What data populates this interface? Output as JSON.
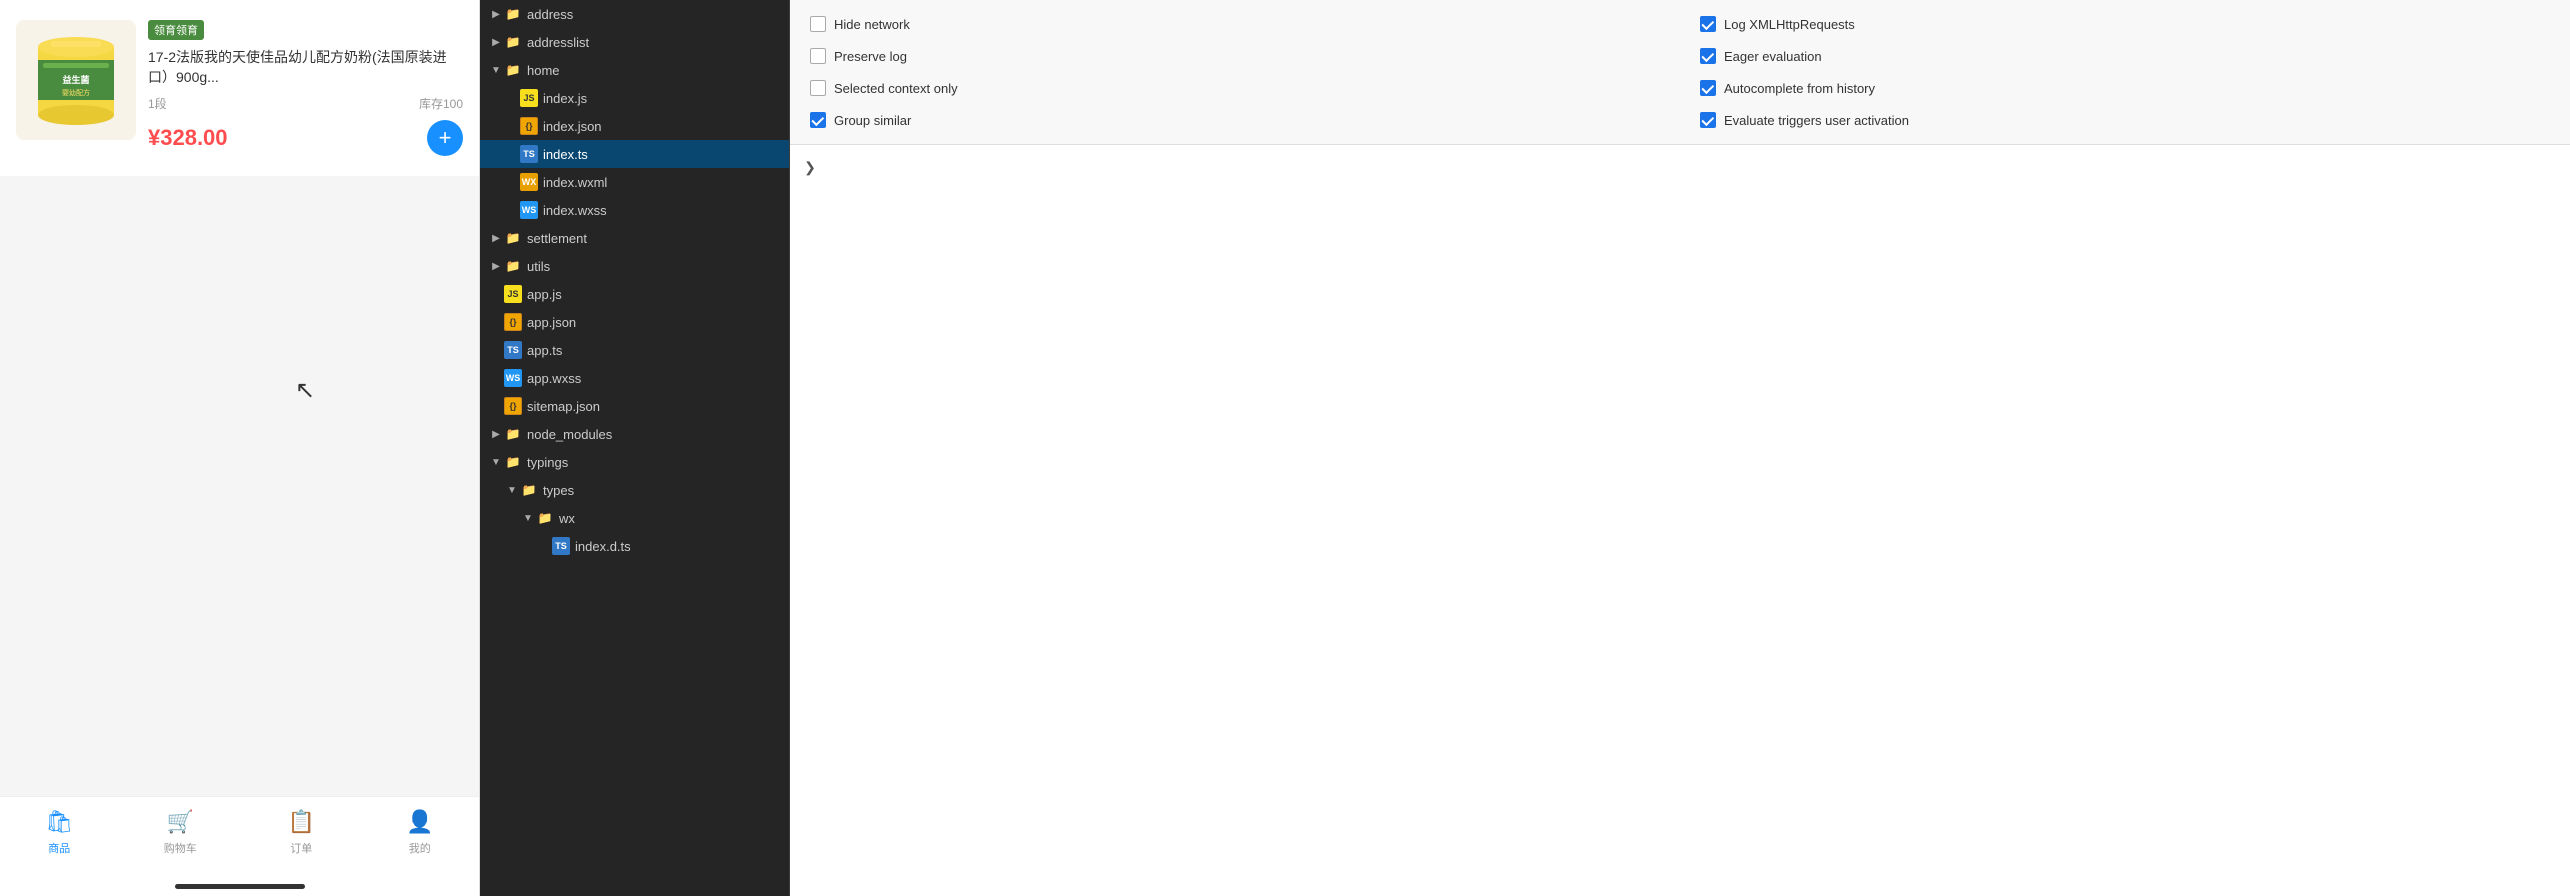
{
  "mobile": {
    "shop_badge": "领育领育",
    "shop_sub": "领育",
    "product_title": "17-2法版我的天使佳品幼儿配方奶粉(法国原装进口）900g...",
    "product_stage": "1段",
    "product_stock": "库存100",
    "product_price": "¥328.00",
    "add_button_label": "+",
    "nav_items": [
      {
        "label": "商品",
        "active": true
      },
      {
        "label": "购物车",
        "active": false
      },
      {
        "label": "订单",
        "active": false
      },
      {
        "label": "我的",
        "active": false
      }
    ]
  },
  "file_tree": {
    "items": [
      {
        "id": "address",
        "name": "address",
        "type": "folder",
        "level": 0,
        "expanded": false,
        "arrow": "▶"
      },
      {
        "id": "addresslist",
        "name": "addresslist",
        "type": "folder",
        "level": 0,
        "expanded": false,
        "arrow": "▶"
      },
      {
        "id": "home",
        "name": "home",
        "type": "folder",
        "level": 0,
        "expanded": true,
        "arrow": "▼"
      },
      {
        "id": "index-js",
        "name": "index.js",
        "type": "js",
        "level": 1
      },
      {
        "id": "index-json",
        "name": "index.json",
        "type": "json",
        "level": 1
      },
      {
        "id": "index-ts",
        "name": "index.ts",
        "type": "ts",
        "level": 1,
        "selected": true
      },
      {
        "id": "index-wxml",
        "name": "index.wxml",
        "type": "wxml",
        "level": 1
      },
      {
        "id": "index-wxss",
        "name": "index.wxss",
        "type": "wxss",
        "level": 1
      },
      {
        "id": "settlement",
        "name": "settlement",
        "type": "folder",
        "level": 0,
        "expanded": false,
        "arrow": "▶"
      },
      {
        "id": "utils",
        "name": "utils",
        "type": "folder",
        "level": 0,
        "expanded": false,
        "arrow": "▶"
      },
      {
        "id": "app-js",
        "name": "app.js",
        "type": "js",
        "level": 0
      },
      {
        "id": "app-json",
        "name": "app.json",
        "type": "json",
        "level": 0
      },
      {
        "id": "app-ts",
        "name": "app.ts",
        "type": "ts",
        "level": 0
      },
      {
        "id": "app-wxss",
        "name": "app.wxss",
        "type": "wxss",
        "level": 0
      },
      {
        "id": "sitemap-json",
        "name": "sitemap.json",
        "type": "json",
        "level": 0
      },
      {
        "id": "node-modules",
        "name": "node_modules",
        "type": "folder",
        "level": 0,
        "expanded": false,
        "arrow": "▶"
      },
      {
        "id": "typings",
        "name": "typings",
        "type": "folder-special",
        "level": 0,
        "expanded": true,
        "arrow": "▼"
      },
      {
        "id": "types",
        "name": "types",
        "type": "folder",
        "level": 1,
        "expanded": true,
        "arrow": "▼"
      },
      {
        "id": "wx",
        "name": "wx",
        "type": "folder",
        "level": 2,
        "expanded": true,
        "arrow": "▼"
      },
      {
        "id": "index-d-ts",
        "name": "index.d.ts",
        "type": "ts",
        "level": 3
      }
    ]
  },
  "devtools": {
    "options": [
      {
        "id": "hide-network",
        "label": "Hide network",
        "checked": false,
        "col": 0
      },
      {
        "id": "log-xmlhttp",
        "label": "Log XMLHttpRequests",
        "checked": true,
        "col": 1
      },
      {
        "id": "preserve-log",
        "label": "Preserve log",
        "checked": false,
        "col": 0
      },
      {
        "id": "eager-eval",
        "label": "Eager evaluation",
        "checked": true,
        "col": 1
      },
      {
        "id": "selected-context",
        "label": "Selected context only",
        "checked": false,
        "col": 0
      },
      {
        "id": "autocomplete-history",
        "label": "Autocomplete from history",
        "checked": true,
        "col": 1
      },
      {
        "id": "group-similar",
        "label": "Group similar",
        "checked": true,
        "col": 0
      },
      {
        "id": "evaluate-triggers",
        "label": "Evaluate triggers user activation",
        "checked": true,
        "col": 1
      }
    ],
    "chevron_right": "❯"
  }
}
